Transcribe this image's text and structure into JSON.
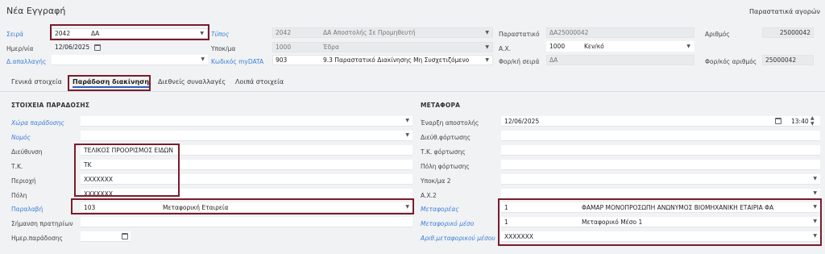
{
  "header": {
    "title": "Νέα Εγγραφή",
    "right_link": "Παραστατικά αγορών"
  },
  "top_form": {
    "seira": {
      "label": "Σειρά",
      "code": "2042",
      "value": "ΔΑ"
    },
    "hmeromhnia": {
      "label": "Ημερ/νία",
      "value": "12/06/2025"
    },
    "apallagh": {
      "label": "Δ.απαλλαγής",
      "value": ""
    },
    "typos": {
      "label": "Τύπος",
      "code": "2042",
      "value": "ΔΑ Αποστολής Σε Προμηθευτή"
    },
    "ypokatasthma": {
      "label": "Υποκ/μα",
      "code": "1000",
      "value": "Έδρα"
    },
    "kwdikos_mydata": {
      "label": "Κωδικός myDATA",
      "code": "903",
      "value": "9.3 Παραστατικό Διακίνησης Μη Συσχετιζόμενο"
    },
    "parastatiko": {
      "label": "Παραστατικό",
      "value": "ΔΑ25000042"
    },
    "ax": {
      "label": "Α.Χ.",
      "code": "1000",
      "value": "Κεν/κό"
    },
    "forikh_seira": {
      "label": "Φορ/κή σειρά",
      "value": "ΔΑ"
    },
    "arithmos": {
      "label": "Αριθμός",
      "value": "25000042"
    },
    "forikos_arithmos": {
      "label": "Φορ/κός αριθμός",
      "value": "25000042"
    }
  },
  "tabs": [
    "Γενικά στοιχεία",
    "Παράδοση διακίνηση",
    "Διεθνείς συναλλαγές",
    "Λοιπά στοιχεία"
  ],
  "delivery": {
    "section_title": "ΣΤΟΙΧΕΙΑ ΠΑΡΑΔΟΣΗΣ",
    "xwra": {
      "label": "Χώρα παράδοσης",
      "value": ""
    },
    "nomos": {
      "label": "Νομός",
      "value": ""
    },
    "dieuthinsi": {
      "label": "Διεύθυνση",
      "value": "ΤΕΛΙΚΟΣ ΠΡΟΟΡΙΣΜΟΣ ΕΙΔΩΝ"
    },
    "tk": {
      "label": "Τ.Κ.",
      "value": "ΤΚ"
    },
    "perioxh": {
      "label": "Περιοχή",
      "value": "XXXXXXX"
    },
    "polh": {
      "label": "Πόλη",
      "value": "XXXXXXX"
    },
    "paralhpths": {
      "label": "Παραλαβή",
      "code": "103",
      "value": "Μεταφορική Εταιρεία"
    },
    "shmansh": {
      "label": "Σήμανση πρατηρίων",
      "value": ""
    },
    "hmer_paradoshs": {
      "label": "Ημερ.παράδοσης",
      "value": ""
    }
  },
  "transport": {
    "section_title": "ΜΕΤΑΦΟΡΑ",
    "enarxh": {
      "label": "Έναρξη αποστολής",
      "date": "12/06/2025",
      "time": "13:40"
    },
    "dieuth_fortwshs": {
      "label": "Διεύθ.φόρτωσης",
      "value": ""
    },
    "tk_fortwshs": {
      "label": "Τ.Κ. φόρτωσης",
      "value": ""
    },
    "polh_fortwshs": {
      "label": "Πόλη φόρτωσης",
      "value": ""
    },
    "ypokatasthma2": {
      "label": "Υποκ/μα 2",
      "value": ""
    },
    "ax2": {
      "label": "Α.Χ.2",
      "value": ""
    },
    "metaforeas": {
      "label": "Μεταφορέας",
      "code": "1",
      "value": "ΦΑΜΑΡ ΜΟΝΟΠΡΟΣΩΠΗ ΑΝΩΝΥΜΟΣ ΒΙΟΜΗΧΑΝΙΚΗ ΕΤΑΙΡΙΑ ΦΑ"
    },
    "metaforiko_meso": {
      "label": "Μεταφορικό μέσο",
      "code": "1",
      "value": "Μεταφορικό Μέσο 1"
    },
    "arith_metaforikou": {
      "label": "Αριθ.μεταφορικού μέσου",
      "value": "XXXXXXX"
    }
  }
}
